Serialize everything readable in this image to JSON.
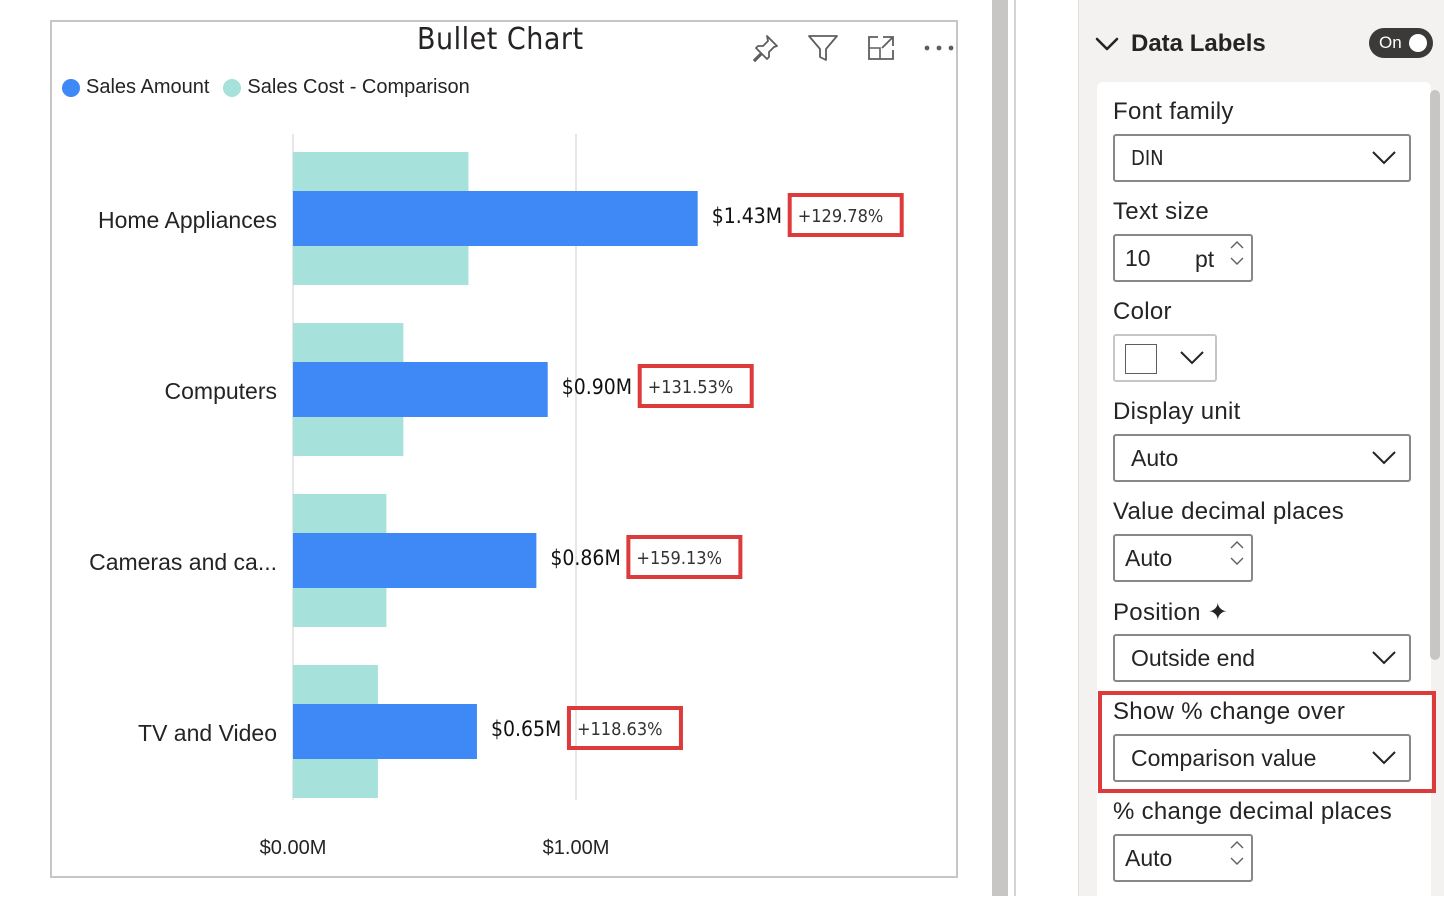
{
  "chart": {
    "title": "Bullet Chart",
    "legend": [
      {
        "label": "Sales Amount",
        "color": "#3e89f5"
      },
      {
        "label": "Sales Cost - Comparison",
        "color": "#a6e1db"
      }
    ],
    "header_icons": [
      "pin-icon",
      "filter-icon",
      "focus-mode-icon",
      "more-options-icon"
    ]
  },
  "chart_data": {
    "type": "bar",
    "orientation": "horizontal",
    "title": "Bullet Chart",
    "categories": [
      "Home Appliances",
      "Computers",
      "Cameras and ca...",
      "TV and Video"
    ],
    "series": [
      {
        "name": "Sales Amount",
        "values": [
          1.43,
          0.9,
          0.86,
          0.65
        ],
        "color": "#3e89f5"
      },
      {
        "name": "Sales Cost - Comparison",
        "values": [
          0.62,
          0.39,
          0.33,
          0.3
        ],
        "color": "#a6e1db"
      }
    ],
    "data_labels": [
      "$1.43M",
      "$0.90M",
      "$0.86M",
      "$0.65M"
    ],
    "pct_change_labels": [
      "+129.78%",
      "+131.53%",
      "+159.13%",
      "+118.63%"
    ],
    "x_ticks": [
      "$0.00M",
      "$1.00M"
    ],
    "xlim": [
      0,
      2.1
    ],
    "unit": "M",
    "gridlines": true,
    "legend_position": "top-left",
    "highlight_color": "#dd3b3b"
  },
  "pane": {
    "section_title": "Data Labels",
    "toggle_label": "On",
    "font_family_label": "Font family",
    "font_family_value": "DIN",
    "text_size_label": "Text size",
    "text_size_value": "10",
    "text_size_unit": "pt",
    "color_label": "Color",
    "display_unit_label": "Display unit",
    "display_unit_value": "Auto",
    "value_decimals_label": "Value decimal places",
    "value_decimals_value": "Auto",
    "position_label": "Position ✦",
    "position_value": "Outside end",
    "show_change_label": "Show % change over",
    "show_change_value": "Comparison value",
    "change_decimals_label": "% change decimal places",
    "change_decimals_value": "Auto"
  }
}
